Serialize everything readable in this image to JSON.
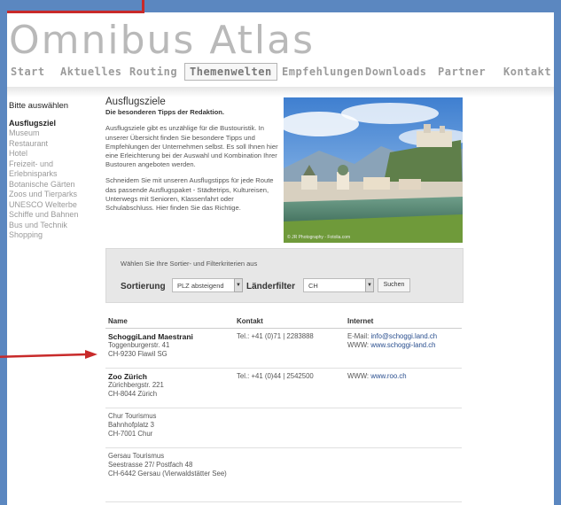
{
  "logo": "Omnibus Atlas",
  "nav": [
    "Start",
    "Aktuelles",
    "Routing",
    "Themenwelten",
    "Empfehlungen",
    "Downloads",
    "Partner",
    "Kontakt"
  ],
  "nav_active": "Themenwelten",
  "sidebar": {
    "heading": "Bitte auswählen",
    "items": [
      "Ausflugsziel",
      "Museum",
      "Restaurant",
      "Hotel",
      "Freizeit- und",
      "Erlebnisparks",
      "Botanische Gärten",
      "Zoos und Tierparks",
      "UNESCO Welterbe",
      "Schiffe und Bahnen",
      "Bus und Technik",
      "Shopping"
    ],
    "active": "Ausflugsziel"
  },
  "intro": {
    "title": "Ausflugsziele",
    "subtitle": "Die besonderen Tipps der Redaktion.",
    "p1": "Ausflugsziele gibt es unzählige für die Bustouristik. In unserer Übersicht finden Sie besondere Tipps und Empfehlungen der Unternehmen selbst. Es soll Ihnen hier eine Erleichterung bei der Auswahl und Kombination Ihrer Bustouren angeboten werden.",
    "p2": "Schneidem Sie mit unseren Ausflugstipps für jede Route das passende Ausflugspaket - Städtetrips, Kultureisen, Unterwegs mit Senioren, Klassenfahrt oder Schulabschluss. Hier finden Sie das Richtige."
  },
  "photo_credit": "© JR Photography - Fotolia.com",
  "filter": {
    "hint": "Wählen Sie Ihre Sortier- und Filterkriterien aus",
    "sort_label": "Sortierung",
    "sort_value": "PLZ absteigend",
    "country_label": "Länderfilter",
    "country_value": "CH",
    "search_button": "Suchen"
  },
  "table": {
    "headers": [
      "Name",
      "Kontakt",
      "Internet"
    ],
    "rows": [
      {
        "name": "SchoggiLand Maestrani",
        "addr1": "Toggenburgerstr. 41",
        "addr2": "CH-9230 Flawil SG",
        "tel": "Tel.: +41 (0)71 | 2283888",
        "email_label": "E-Mail:",
        "email": "info@schoggi.land.ch",
        "www_label": "WWW:",
        "www": "www.schoggi-land.ch"
      },
      {
        "name": "Zoo Zürich",
        "addr1": "Zürichbergstr. 221",
        "addr2": "CH-8044 Zürich",
        "tel": "Tel.: +41 (0)44 | 2542500",
        "email_label": "",
        "email": "",
        "www_label": "WWW:",
        "www": "www.roo.ch"
      },
      {
        "name": "Chur Tourismus",
        "addr1": "Bahnhofplatz 3",
        "addr2": "CH-7001 Chur",
        "tel": "",
        "email_label": "",
        "email": "",
        "www_label": "",
        "www": ""
      },
      {
        "name": "Gersau Tourismus",
        "addr1": "Seestrasse 27/ Postfach 48",
        "addr2": "CH-6442 Gersau (Vierwaldstätter See)",
        "tel": "",
        "email_label": "",
        "email": "",
        "www_label": "",
        "www": ""
      }
    ]
  }
}
